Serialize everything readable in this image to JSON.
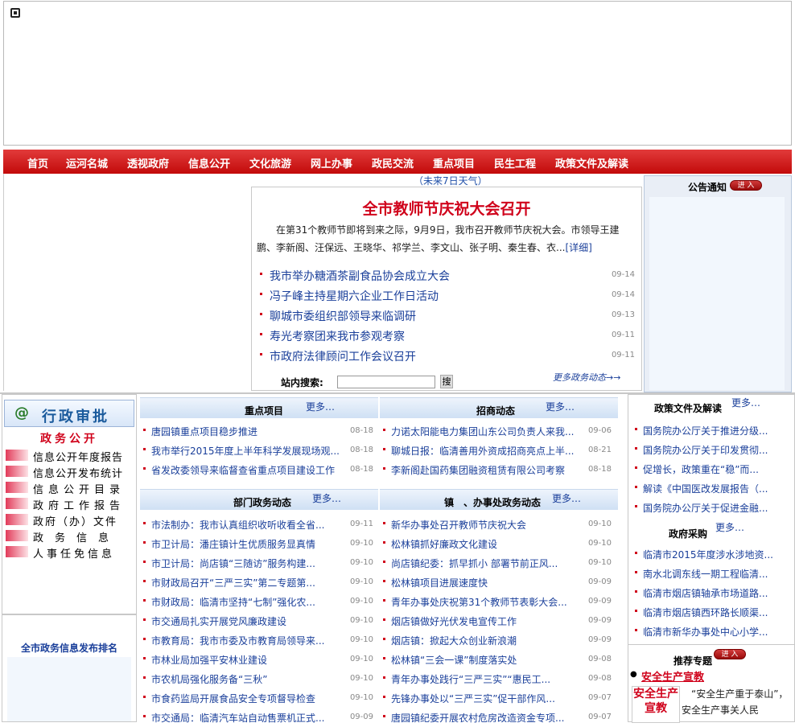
{
  "nav": {
    "items": [
      "首页",
      "运河名城",
      "透视政府",
      "信息公开",
      "文化旅游",
      "网上办事",
      "政民交流",
      "重点项目",
      "民生工程",
      "政策文件及解读"
    ]
  },
  "weather": "（未来7日天气）",
  "news": {
    "headline": "全市教师节庆祝大会召开",
    "lead": "在第31个教师节即将到来之际，9月9日，我市召开教师节庆祝大会。市领导王建鹏、李新阁、汪保远、王晓华、祁学兰、李文山、张子明、秦生春、衣...",
    "detail_link": "[详细]",
    "items": [
      {
        "title": "我市举办糖酒茶副食品协会成立大会",
        "date": "09-14"
      },
      {
        "title": "冯子峰主持星期六企业工作日活动",
        "date": "09-14"
      },
      {
        "title": "聊城市委组织部领导来临调研",
        "date": "09-13"
      },
      {
        "title": "寿光考察团来我市参观考察",
        "date": "09-11"
      },
      {
        "title": "市政府法律顾问工作会议召开",
        "date": "09-11"
      }
    ],
    "search_label": "站内搜索:",
    "search_button": "搜",
    "more_dynamics": "更多政务动态→→"
  },
  "notice": {
    "title": "公告通知",
    "enter": "进 入"
  },
  "left": {
    "xzsp": "行政审批",
    "xzsp_icon": "@",
    "zwgk": "政务公开",
    "menu": [
      "信息公开年度报告",
      "信息公开发布统计",
      "信息公开目录",
      "政府工作报告",
      "政府（办）文件",
      "政务信息",
      "人事任免信息"
    ],
    "rank_title": "全市政务信息发布排名"
  },
  "sections": {
    "more": "更多…",
    "key_projects": {
      "title": "重点项目",
      "items": [
        {
          "title": "唐园镇重点项目稳步推进",
          "date": "08-18"
        },
        {
          "title": "我市举行2015年度上半年科学发展现场观...",
          "date": "08-18"
        },
        {
          "title": "省发改委领导来临督查省重点项目建设工作",
          "date": "08-18"
        }
      ]
    },
    "investment": {
      "title": "招商动态",
      "items": [
        {
          "title": "力诺太阳能电力集团山东公司负责人来我...",
          "date": "09-06"
        },
        {
          "title": "聊城日报：临清善用外资成招商亮点上半...",
          "date": "08-21"
        },
        {
          "title": "李新阁赴国药集团融资租赁有限公司考察",
          "date": "08-18"
        }
      ]
    },
    "departments": {
      "title": "部门政务动态",
      "items": [
        {
          "title": "市法制办：我市认真组织收听收看全省...",
          "date": "09-11"
        },
        {
          "title": "市卫计局：潘庄镇计生优质服务显真情",
          "date": "09-10"
        },
        {
          "title": "市卫计局：尚店镇“三随访”服务构建...",
          "date": "09-10"
        },
        {
          "title": "市财政局召开“三严三实”第二专题第...",
          "date": "09-10"
        },
        {
          "title": "市财政局：临清市坚持“七制”强化农...",
          "date": "09-10"
        },
        {
          "title": "市交通局扎实开展党风廉政建设",
          "date": "09-10"
        },
        {
          "title": "市教育局：我市市委及市教育局领导来...",
          "date": "09-10"
        },
        {
          "title": "市林业局加强平安林业建设",
          "date": "09-10"
        },
        {
          "title": "市农机局强化服务备“三秋”",
          "date": "09-10"
        },
        {
          "title": "市食药监局开展食品安全专项督导检查",
          "date": "09-10"
        },
        {
          "title": "市交通局：临清汽车站自动售票机正式...",
          "date": "09-09"
        }
      ]
    },
    "towns": {
      "title": "镇　、办事处政务动态",
      "items": [
        {
          "title": "新华办事处召开教师节庆祝大会",
          "date": "09-10"
        },
        {
          "title": "松林镇抓好廉政文化建设",
          "date": "09-10"
        },
        {
          "title": "尚店镇纪委：抓早抓小 部署节前正风...",
          "date": "09-10"
        },
        {
          "title": "松林镇项目进展速度快",
          "date": "09-09"
        },
        {
          "title": "青年办事处庆祝第31个教师节表彰大会...",
          "date": "09-09"
        },
        {
          "title": "烟店镇做好光伏发电宣传工作",
          "date": "09-09"
        },
        {
          "title": "烟店镇：掀起大众创业新浪潮",
          "date": "09-09"
        },
        {
          "title": "松林镇“三会一课”制度落实处",
          "date": "09-08"
        },
        {
          "title": "青年办事处践行“三严三实”“惠民工...",
          "date": "09-08"
        },
        {
          "title": "先锋办事处以“三严三实”促干部作风...",
          "date": "09-07"
        },
        {
          "title": "唐园镇纪委开展农村危房改造资金专项...",
          "date": "09-07"
        }
      ]
    }
  },
  "right": {
    "policy_title": "政策文件及解读",
    "policy_items": [
      "国务院办公厅关于推进分级...",
      "国务院办公厅关于印发贯彻...",
      "促增长，政策重在“稳”而...",
      "解读《中国医改发展报告（...",
      "国务院办公厅关于促进金融..."
    ],
    "procure_title": "政府采购",
    "procure_items": [
      "临清市2015年度涉水涉地资...",
      "南水北调东线一期工程临清...",
      "临清市烟店镇轴承市场道路...",
      "临清市烟店镇西环路长顺渠...",
      "临清市新华办事处中心小学..."
    ],
    "topic_title": "推荐专题",
    "topic_enter": "进 入",
    "topic_link": "安全生产宣教",
    "topic_image_text": "安全生产宣教",
    "topic_quote": "“安全生产重于泰山”，安全生产事关人民"
  },
  "colors": {
    "nav_red": "#c20a0a",
    "headline_red": "#d0021b",
    "link_blue": "#1a3f9a"
  }
}
